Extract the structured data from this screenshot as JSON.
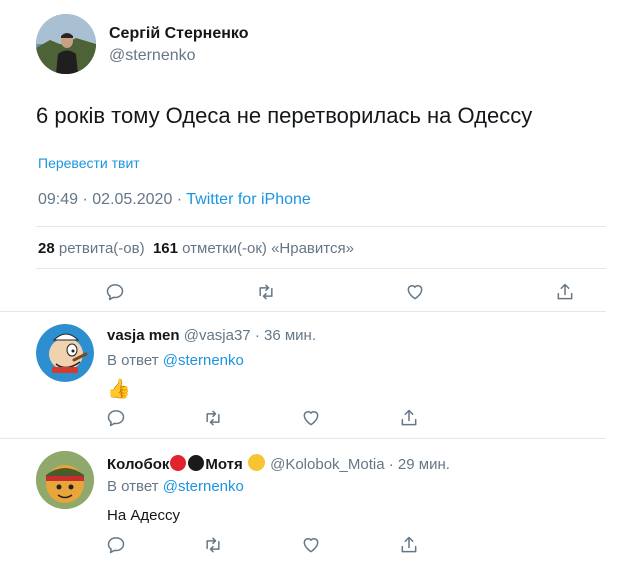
{
  "tweet": {
    "author_name": "Сергій Стерненко",
    "author_handle": "@sternenko",
    "text": "6 років тому Одеса не перетворилась на Одессу",
    "translate_label": "Перевести твит",
    "time": "09:49",
    "separator": " · ",
    "date": "02.05.2020",
    "source": "Twitter for iPhone",
    "retweets_count": "28",
    "retweets_label": "ретвита(-ов)",
    "likes_count": "161",
    "likes_label": "отметки(-ок) «Нравится»"
  },
  "replies": [
    {
      "name": "vasja men",
      "handle": "@vasja37",
      "time": "· 36 мин.",
      "reply_to_label": "В ответ",
      "reply_to_handle": "@sternenko",
      "text": "👍"
    },
    {
      "name": "Колобок",
      "name_suffix": "Мотя",
      "handle": "@Kolobok_Motia",
      "time": "· 29 мин.",
      "reply_to_label": "В ответ",
      "reply_to_handle": "@sternenko",
      "text": "На Адессу"
    }
  ],
  "icons": {
    "reply": "reply-icon",
    "retweet": "retweet-icon",
    "like": "heart-icon",
    "share": "share-icon"
  },
  "colors": {
    "link": "#1b95e0",
    "secondary_text": "#657786",
    "divider": "#e1e8ed"
  }
}
